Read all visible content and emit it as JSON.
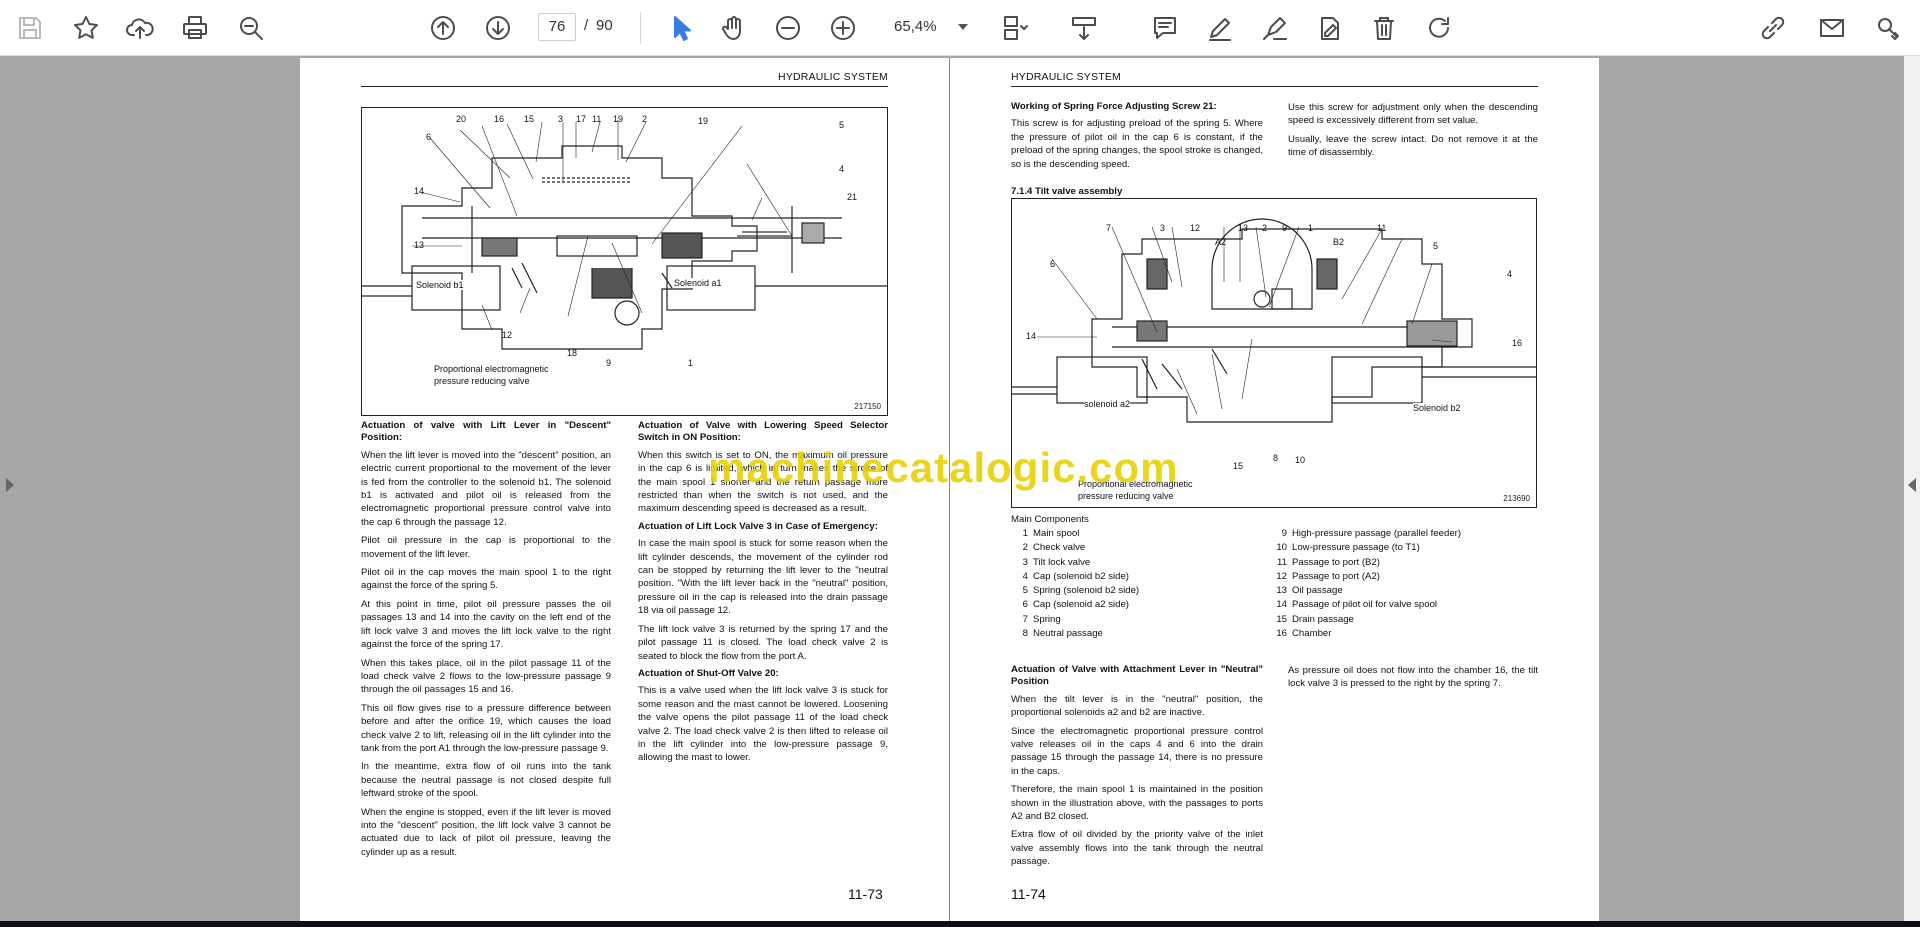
{
  "toolbar": {
    "page_current": "76",
    "page_separator": "/",
    "page_total": "90",
    "zoom": "65,4%",
    "icons": [
      "save-icon",
      "bookmark-star-icon",
      "upload-icon",
      "print-icon",
      "zoom-out-search-icon",
      "prev-page-icon",
      "next-page-icon",
      "select-arrow-icon",
      "hand-tool-icon",
      "zoom-out-icon",
      "zoom-in-icon",
      "page-layout-icon",
      "scroll-mode-icon",
      "comment-icon",
      "pen-icon",
      "highlight-icon",
      "sign-icon",
      "delete-icon",
      "redo-icon",
      "attach-link-icon",
      "email-icon",
      "tools-icon"
    ]
  },
  "watermark": "machinecatalogic.com",
  "left_page": {
    "header": "HYDRAULIC SYSTEM",
    "figure_number": "217150",
    "callouts": [
      "20",
      "16",
      "15",
      "3",
      "17",
      "11",
      "19",
      "2",
      "19",
      "5",
      "6",
      "4",
      "14",
      "21",
      "13",
      "12",
      "18",
      "9",
      "1"
    ],
    "solenoid_b1": "Solenoid b1",
    "solenoid_a1": "Solenoid a1",
    "figure_caption_1": "Proportional electromagnetic",
    "figure_caption_2": "pressure reducing valve",
    "col1": [
      {
        "h": "Actuation of valve with Lift Lever in \"Descent\" Position:"
      },
      {
        "p": "When the lift lever is moved into the \"descent\" position, an electric current proportional to the movement of the lever is fed from the controller to the solenoid b1. The solenoid b1 is activated and pilot oil is released from the electromagnetic proportional pressure control valve into the cap 6 through the passage 12."
      },
      {
        "p": "Pilot oil pressure in the cap is proportional to the movement of the lift lever."
      },
      {
        "p": "Pilot oil in the cap moves the main spool 1 to the right against the force of the spring 5."
      },
      {
        "p": "At this point in time, pilot oil pressure passes the oil passages 13 and 14 into the cavity on the left end of the lift lock valve 3 and moves the lift lock valve to the right against the force of the spring 17."
      },
      {
        "p": "When this takes place, oil in the pilot passage 11 of the load check valve 2 flows to the low-pressure passage 9 through the oil passages 15 and 16."
      },
      {
        "p": "This oil flow gives rise to a pressure difference between before and after the orifice 19, which causes the load check valve 2 to lift, releasing oil in the lift cylinder into the tank from the port A1 through the low-pressure passage 9."
      },
      {
        "p": "In the meantime, extra flow of oil runs into the tank because the neutral passage is not closed despite full leftward stroke of the spool."
      },
      {
        "p": "When the engine is stopped, even if the lift lever is moved into the \"descent\" position, the lift lock valve 3 cannot be actuated due to lack of pilot oil pressure, leaving the cylinder up as a result."
      }
    ],
    "col2": [
      {
        "h": "Actuation of Valve with Lowering Speed Selector Switch in ON Position:"
      },
      {
        "p": "When this switch is set to ON, the maximum oil pressure in the cap 6 is limited, which in turn makes the stroke of the main spool 1 shorter and the return passage more restricted than when the switch is not used, and the maximum descending speed is decreased as a result."
      },
      {
        "h": "Actuation of Lift Lock Valve 3 in Case of Emergency:"
      },
      {
        "p": "In case the main spool is stuck for some reason when the lift cylinder descends, the movement of the cylinder rod can be stopped by returning the lift lever to the \"neutral position. \"With the lift lever back in the \"neutral\" position, pressure oil in the cap is released into the drain passage 18 via oil passage 12."
      },
      {
        "p": "The lift lock valve 3 is returned by the spring 17 and the pilot passage 11 is closed. The load check valve 2 is seated to block the flow from the port A."
      },
      {
        "h": "Actuation of Shut-Off Valve 20:"
      },
      {
        "p": "This is a valve used when the lift lock valve 3 is stuck for some reason and the mast cannot be lowered. Loosening the valve opens the pilot passage 11 of the load check valve 2. The load check valve 2 is then lifted to release oil in the lift cylinder into the low-pressure passage 9, allowing the mast to lower."
      }
    ],
    "page_number": "11-73"
  },
  "right_page": {
    "header": "HYDRAULIC SYSTEM",
    "top_col1": [
      {
        "h": "Working of Spring Force Adjusting Screw 21:"
      },
      {
        "p": "This screw is for adjusting preload of the spring 5. Where the pressure of pilot oil in the cap 6 is constant, if the preload of the spring changes, the spool stroke is changed, so is the descending speed."
      }
    ],
    "top_col2": [
      {
        "p": "Use this screw for adjustment only when the descending speed is excessively different from set value."
      },
      {
        "p": "Usually, leave the screw intact. Do not remove it at the time of disassembly."
      }
    ],
    "section_title": "7.1.4  Tilt valve assembly",
    "figure_number": "213690",
    "callouts": [
      "7",
      "3",
      "12",
      "A2",
      "13",
      "2",
      "9",
      "1",
      "B2",
      "11",
      "6",
      "5",
      "4",
      "14",
      "16",
      "15",
      "8",
      "10"
    ],
    "solenoid_a2": "solenoid a2",
    "solenoid_b2": "Solenoid b2",
    "figure_caption_1": "Proportional electromagnetic",
    "figure_caption_2": "pressure reducing valve",
    "components_title": "Main Components",
    "components_left": [
      {
        "n": "1",
        "t": "Main spool"
      },
      {
        "n": "2",
        "t": "Check valve"
      },
      {
        "n": "3",
        "t": "Tilt lock valve"
      },
      {
        "n": "4",
        "t": "Cap (solenoid b2 side)"
      },
      {
        "n": "5",
        "t": "Spring (solenoid b2 side)"
      },
      {
        "n": "6",
        "t": "Cap (solenoid a2 side)"
      },
      {
        "n": "7",
        "t": "Spring"
      },
      {
        "n": "8",
        "t": "Neutral passage"
      }
    ],
    "components_right": [
      {
        "n": "9",
        "t": "High-pressure passage (parallel feeder)"
      },
      {
        "n": "10",
        "t": "Low-pressure passage (to T1)"
      },
      {
        "n": "11",
        "t": "Passage to port (B2)"
      },
      {
        "n": "12",
        "t": "Passage to port (A2)"
      },
      {
        "n": "13",
        "t": "Oil passage"
      },
      {
        "n": "14",
        "t": "Passage of pilot oil for valve spool"
      },
      {
        "n": "15",
        "t": "Drain passage"
      },
      {
        "n": "16",
        "t": "Chamber"
      }
    ],
    "bottom_col1": [
      {
        "h": "Actuation of Valve with Attachment Lever in \"Neutral\" Position"
      },
      {
        "p": "When the tilt lever is in the \"neutral\" position, the proportional solenoids a2 and b2 are inactive."
      },
      {
        "p": "Since the electromagnetic proportional pressure control valve releases oil in the caps 4 and 6 into the drain passage 15 through the passage 14, there is no pressure in the caps."
      },
      {
        "p": "Therefore, the main spool 1 is maintained in the position shown in the illustration above, with the passages to ports A2 and B2 closed."
      },
      {
        "p": "Extra flow of oil divided by the priority valve of the inlet valve assembly flows into the tank through the neutral passage."
      }
    ],
    "bottom_col2": [
      {
        "p": "As pressure oil does not flow into the chamber 16, the tilt lock valve 3 is pressed to the right by the spring 7."
      }
    ],
    "page_number": "11-74"
  }
}
